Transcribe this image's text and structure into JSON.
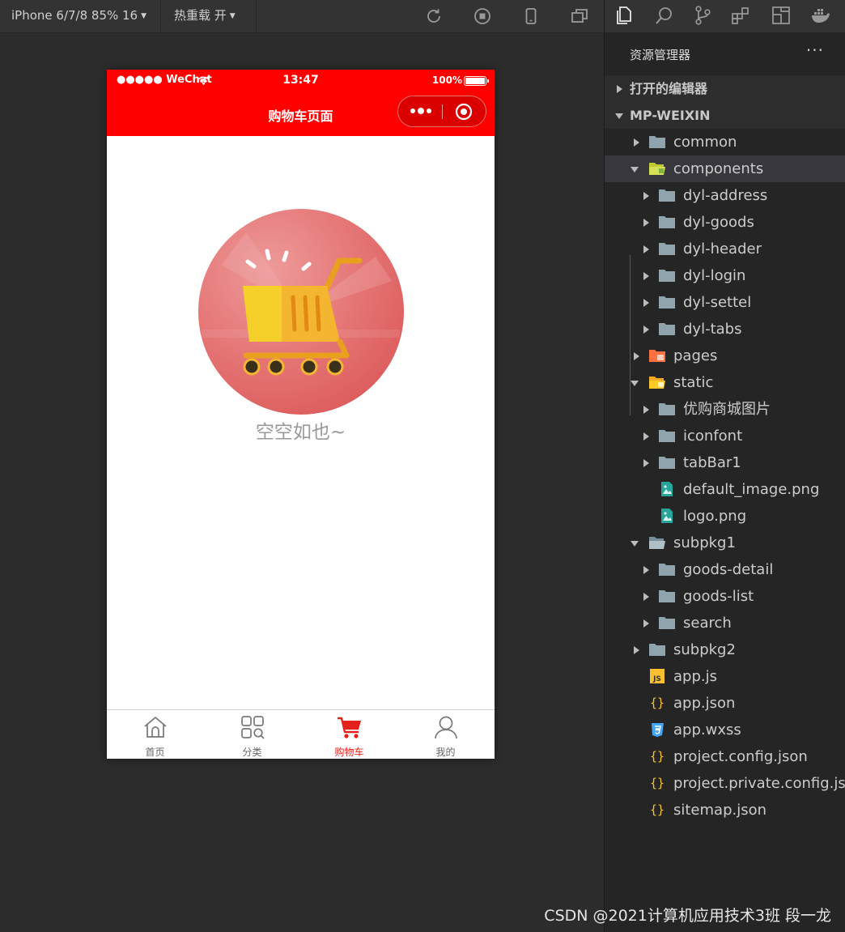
{
  "toolbar": {
    "device": "iPhone 6/7/8 85% 16",
    "hot_reload": "热重载 开"
  },
  "phone": {
    "statusbar": {
      "signal_carrier": "●●●●● WeChat",
      "time": "13:47",
      "battery": "100%"
    },
    "navbar": {
      "title": "购物车页面"
    },
    "empty": {
      "text": "空空如也~"
    },
    "tabbar": [
      {
        "label": "首页",
        "icon": "home-icon",
        "active": false
      },
      {
        "label": "分类",
        "icon": "category-icon",
        "active": false
      },
      {
        "label": "购物车",
        "icon": "cart-icon",
        "active": true
      },
      {
        "label": "我的",
        "icon": "user-icon",
        "active": false
      }
    ],
    "accent_color": "#ff0000"
  },
  "explorer": {
    "title": "资源管理器",
    "more": "···",
    "sections": {
      "open_editors": "打开的编辑器",
      "project": "MP-WEIXIN"
    },
    "tree": [
      {
        "label": "common",
        "icon": "folder-icon"
      },
      {
        "label": "components",
        "icon": "folder-open-icon"
      },
      {
        "label": "dyl-address",
        "icon": "folder-icon"
      },
      {
        "label": "dyl-goods",
        "icon": "folder-icon"
      },
      {
        "label": "dyl-header",
        "icon": "folder-icon"
      },
      {
        "label": "dyl-login",
        "icon": "folder-icon"
      },
      {
        "label": "dyl-settel",
        "icon": "folder-icon"
      },
      {
        "label": "dyl-tabs",
        "icon": "folder-icon"
      },
      {
        "label": "pages",
        "icon": "pages-folder-icon"
      },
      {
        "label": "static",
        "icon": "folder-open-icon"
      },
      {
        "label": "优购商城图片",
        "icon": "folder-icon"
      },
      {
        "label": "iconfont",
        "icon": "folder-icon"
      },
      {
        "label": "tabBar1",
        "icon": "folder-icon"
      },
      {
        "label": "default_image.png",
        "icon": "image-file-icon"
      },
      {
        "label": "logo.png",
        "icon": "image-file-icon"
      },
      {
        "label": "subpkg1",
        "icon": "folder-open-icon"
      },
      {
        "label": "goods-detail",
        "icon": "folder-icon"
      },
      {
        "label": "goods-list",
        "icon": "folder-icon"
      },
      {
        "label": "search",
        "icon": "folder-icon"
      },
      {
        "label": "subpkg2",
        "icon": "folder-icon"
      },
      {
        "label": "app.js",
        "icon": "js-file-icon"
      },
      {
        "label": "app.json",
        "icon": "json-file-icon"
      },
      {
        "label": "app.wxss",
        "icon": "css-file-icon"
      },
      {
        "label": "project.config.json",
        "icon": "json-file-icon"
      },
      {
        "label": "project.private.config.js...",
        "icon": "json-file-icon"
      },
      {
        "label": "sitemap.json",
        "icon": "json-file-icon"
      }
    ]
  },
  "watermark": "CSDN @2021计算机应用技术3班 段一龙"
}
